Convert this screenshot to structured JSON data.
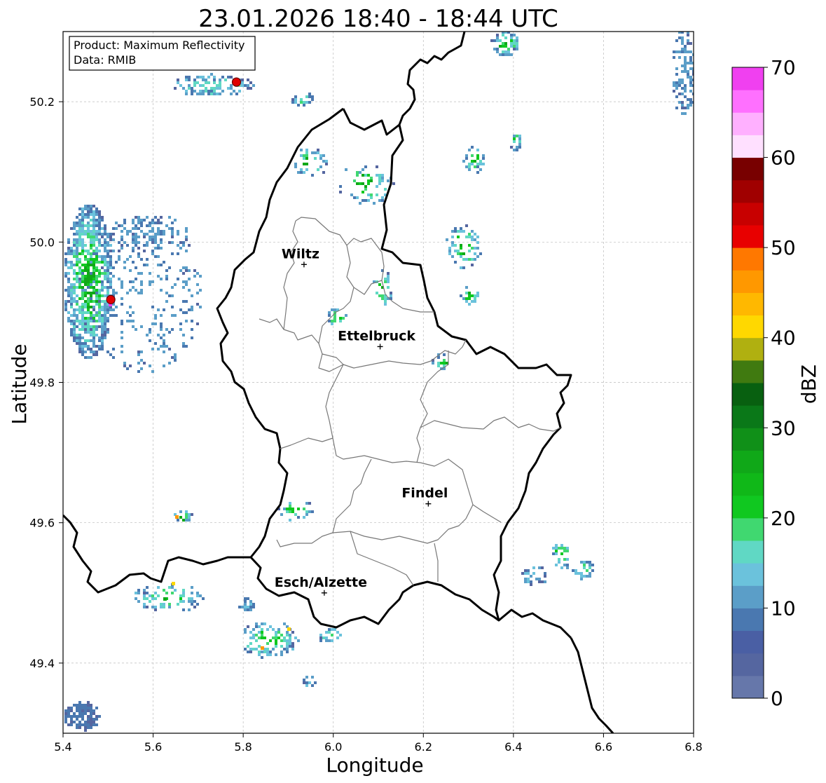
{
  "title": "23.01.2026 18:40 - 18:44 UTC",
  "info": {
    "product": "Product: Maximum Reflectivity",
    "data": "Data: RMIB"
  },
  "axes": {
    "xlabel": "Longitude",
    "ylabel": "Latitude",
    "xlim": [
      5.4,
      6.8
    ],
    "ylim": [
      49.3,
      50.3
    ],
    "xticks": [
      "5.4",
      "5.6",
      "5.8",
      "6.0",
      "6.2",
      "6.4",
      "6.6",
      "6.8"
    ],
    "yticks": [
      "49.4",
      "49.6",
      "49.8",
      "50.0",
      "50.2"
    ],
    "grid": true
  },
  "colorbar": {
    "label": "dBZ",
    "ticks": [
      "0",
      "10",
      "20",
      "30",
      "40",
      "50",
      "60",
      "70"
    ],
    "range": [
      0,
      70
    ],
    "colors": [
      "#6677aa",
      "#5566a0",
      "#4a5fa4",
      "#4a78b0",
      "#5b9ec8",
      "#6bc2dc",
      "#60d8c4",
      "#40d870",
      "#10c820",
      "#10b818",
      "#10a818",
      "#109018",
      "#0a7818",
      "#086010",
      "#407a10",
      "#b0b010",
      "#ffd800",
      "#ffb800",
      "#ff9800",
      "#ff7800",
      "#e80000",
      "#c80000",
      "#a00000",
      "#780000",
      "#ffe0ff",
      "#ffb0ff",
      "#ff70ff",
      "#f040f0"
    ]
  },
  "cities": [
    {
      "name": "Wiltz",
      "lon": 5.935,
      "lat": 49.968
    },
    {
      "name": "Ettelbruck",
      "lon": 6.104,
      "lat": 49.851
    },
    {
      "name": "Findel",
      "lon": 6.211,
      "lat": 49.627
    },
    {
      "name": "Esch/Alzette",
      "lon": 5.98,
      "lat": 49.5
    }
  ],
  "markers": [
    {
      "lon": 5.785,
      "lat": 50.228
    },
    {
      "lon": 5.506,
      "lat": 49.918
    }
  ]
}
